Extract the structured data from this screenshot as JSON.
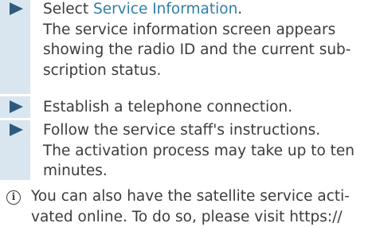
{
  "steps": [
    {
      "prefix": "Select ",
      "link": "Service Information",
      "suffix": ".",
      "detail_lines": [
        "The service information screen appears",
        "showing the radio ID and the current sub-",
        "scription status."
      ]
    },
    {
      "text": "Establish a telephone connection."
    },
    {
      "text": "Follow the service staff's instructions.",
      "detail_lines": [
        "The activation process may take up to ten",
        "minutes."
      ]
    }
  ],
  "note": {
    "icon": "info-icon",
    "lines": [
      "You can also have the satellite service acti-",
      "vated online. To do so, please visit https://"
    ]
  },
  "colors": {
    "stripe": "#d9e6f0",
    "arrow": "#2f5a7e",
    "link": "#2f7fa6",
    "text": "#3c3c3c"
  }
}
